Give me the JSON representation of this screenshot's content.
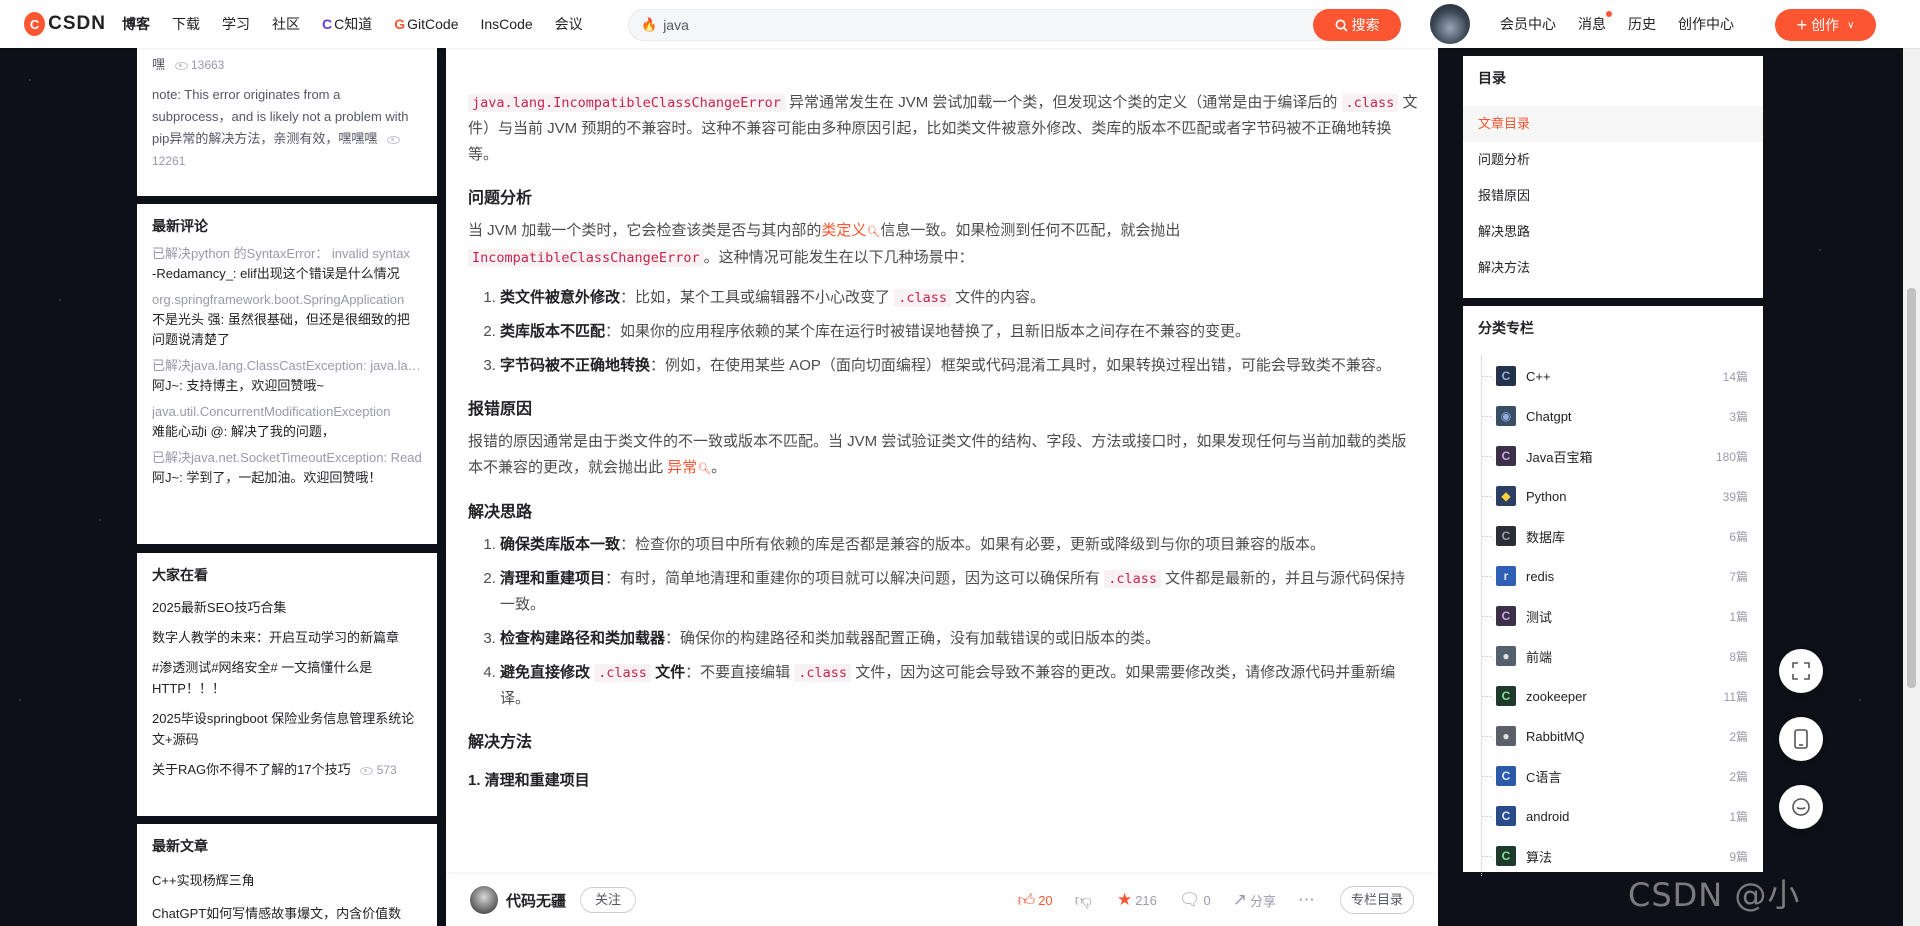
{
  "topbar": {
    "logo_text": "CSDN",
    "nav": [
      {
        "label": "博客",
        "active": true
      },
      {
        "label": "下载"
      },
      {
        "label": "学习"
      },
      {
        "label": "社区"
      },
      {
        "label": "C知道",
        "icon": "C"
      },
      {
        "label": "GitCode",
        "icon": "G"
      },
      {
        "label": "InsCode"
      },
      {
        "label": "会议"
      }
    ],
    "search_value": "java",
    "search_button": "搜索",
    "right_links": [
      "会员中心",
      "消息",
      "历史",
      "创作中心"
    ],
    "create_button": "创作"
  },
  "left": {
    "top_card": {
      "items": [
        {
          "text": "嘿",
          "views": "13663"
        },
        {
          "text": "note: This error originates from a subprocess，and is likely not a problem with pip异常的解决方法，亲测有效，嘿嘿嘿",
          "views": "12261"
        }
      ]
    },
    "latest_comments": {
      "title": "最新评论",
      "items": [
        {
          "title": "已解决python 的SyntaxError： invalid syntax",
          "body": "-Redamancy_: elif出现这个错误是什么情况"
        },
        {
          "title": "org.springframework.boot.SpringApplication",
          "body": "不是光头 强: 虽然很基础，但还是很细致的把问题说清楚了"
        },
        {
          "title": "已解决java.lang.ClassCastException: java.lang",
          "body": "阿J~: 支持博主，欢迎回赞哦~"
        },
        {
          "title": "java.util.ConcurrentModificationException",
          "body": "难能心动i @: 解决了我的问题，"
        },
        {
          "title": "已解决java.net.SocketTimeoutException: Read",
          "body": "阿J~: 学到了，一起加油。欢迎回赞哦！"
        }
      ]
    },
    "everyone_watching": {
      "title": "大家在看",
      "items": [
        {
          "text": "2025最新SEO技巧合集"
        },
        {
          "text": "数字人教学的未来：开启互动学习的新篇章"
        },
        {
          "text": "#渗透测试#网络安全# 一文搞懂什么是HTTP！！！"
        },
        {
          "text": "2025毕设springboot 保险业务信息管理系统论文+源码"
        },
        {
          "text": "关于RAG你不得不了解的17个技巧",
          "views": "573"
        }
      ]
    },
    "latest_articles": {
      "title": "最新文章",
      "items": [
        "C++实现杨辉三角",
        "ChatGPT如何写情感故事爆文，内含价值数"
      ]
    }
  },
  "article": {
    "intro_code": "java.lang.IncompatibleClassChangeError",
    "intro_1": " 异常通常发生在 JVM 尝试加载一个类，但发现这个类的定义（通常是由于编译后的 ",
    "intro_code2": ".class",
    "intro_2": " 文件）与当前 JVM 预期的不兼容时。这种不兼容可能由多种原因引起，比如类文件被意外修改、类库的版本不匹配或者字节码被不正确地转换等。",
    "h_analysis": "问题分析",
    "analysis_1": "当 JVM 加载一个类时，它会检查该类是否与其内部的",
    "analysis_kw": "类定义",
    "analysis_2": "信息一致。如果检测到任何不匹配，就会抛出 ",
    "analysis_code": "IncompatibleClassChangeError",
    "analysis_3": "。这种情况可能发生在以下几种场景中：",
    "scenarios": [
      {
        "b": "类文件被意外修改",
        "t1": "：比如，某个工具或编辑器不小心改变了 ",
        "code": ".class",
        "t2": " 文件的内容。"
      },
      {
        "b": "类库版本不匹配",
        "t1": "：如果你的应用程序依赖的某个库在运行时被错误地替换了，且新旧版本之间存在不兼容的变更。",
        "code": "",
        "t2": ""
      },
      {
        "b": "字节码被不正确地转换",
        "t1": "：例如，在使用某些 AOP（面向切面编程）框架或代码混淆工具时，如果转换过程出错，可能会导致类不兼容。",
        "code": "",
        "t2": ""
      }
    ],
    "h_cause": "报错原因",
    "cause_1": "报错的原因通常是由于类文件的不一致或版本不匹配。当 JVM 尝试验证类文件的结构、字段、方法或接口时，如果发现任何与当前加载的类版本不兼容的更改，就会抛出此 ",
    "cause_kw": "异常",
    "cause_2": "。",
    "h_ideas": "解决思路",
    "ideas": [
      {
        "b": "确保类库版本一致",
        "t1": "：检查你的项目中所有依赖的库是否都是兼容的版本。如果有必要，更新或降级到与你的项目兼容的版本。",
        "code": "",
        "t2": "",
        "bcode": ""
      },
      {
        "b": "清理和重建项目",
        "t1": "：有时，简单地清理和重建你的项目就可以解决问题，因为这可以确保所有 ",
        "code": ".class",
        "t2": " 文件都是最新的，并且与源代码保持一致。",
        "bcode": ""
      },
      {
        "b": "检查构建路径和类加载器",
        "t1": "：确保你的构建路径和类加载器配置正确，没有加载错误的或旧版本的类。",
        "code": "",
        "t2": "",
        "bcode": ""
      },
      {
        "b": "避免直接修改 ",
        "bcode": ".class",
        "b2": " 文件",
        "t1": "：不要直接编辑 ",
        "code": ".class",
        "t2": " 文件，因为这可能会导致不兼容的更改。如果需要修改类，请修改源代码并重新编译。"
      }
    ],
    "h_method": "解决方法",
    "cut_text": "1. 清理和重建项目"
  },
  "bottombar": {
    "author": "代码无疆",
    "follow": "关注",
    "likes": "20",
    "favorites": "216",
    "comments": "0",
    "share": "分享",
    "column_toc": "专栏目录"
  },
  "right": {
    "toc": {
      "title": "目录",
      "items": [
        "文章目录",
        "问题分析",
        "报错原因",
        "解决思路",
        "解决方法"
      ]
    },
    "columns": {
      "title": "分类专栏",
      "items": [
        {
          "name": "C++",
          "count": "14篇"
        },
        {
          "name": "Chatgpt",
          "count": "3篇"
        },
        {
          "name": "Java百宝箱",
          "count": "180篇"
        },
        {
          "name": "Python",
          "count": "39篇"
        },
        {
          "name": "数据库",
          "count": "6篇"
        },
        {
          "name": "redis",
          "count": "7篇"
        },
        {
          "name": "测试",
          "count": "1篇"
        },
        {
          "name": "前端",
          "count": "8篇"
        },
        {
          "name": "zookeeper",
          "count": "11篇"
        },
        {
          "name": "RabbitMQ",
          "count": "2篇"
        },
        {
          "name": "C语言",
          "count": "2篇"
        },
        {
          "name": "android",
          "count": "1篇"
        },
        {
          "name": "算法",
          "count": "9篇"
        }
      ]
    }
  },
  "watermark": "CSDN @小",
  "colors": {
    "accent": "#fc5531",
    "code_text": "#c7254e",
    "code_bg": "#f9f2f4"
  }
}
